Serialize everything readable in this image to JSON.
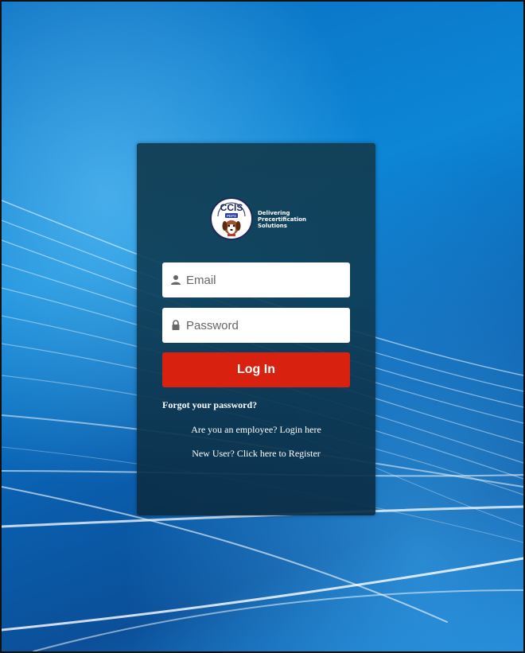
{
  "logo": {
    "brand": "CCIS",
    "badge": "PEPS",
    "tagline": [
      "Delivering",
      "Precertification",
      "Solutions"
    ]
  },
  "form": {
    "email_placeholder": "Email",
    "password_placeholder": "Password",
    "login_label": "Log In",
    "forgot_label": "Forgot your password?",
    "employee_label": "Are you an employee? Login here",
    "register_label": "New User? Click here to Register"
  },
  "icons": {
    "email": "user-icon",
    "password": "lock-icon"
  },
  "colors": {
    "accent": "#d8210e",
    "panel": "#123e54",
    "background": "#0d86d6"
  }
}
